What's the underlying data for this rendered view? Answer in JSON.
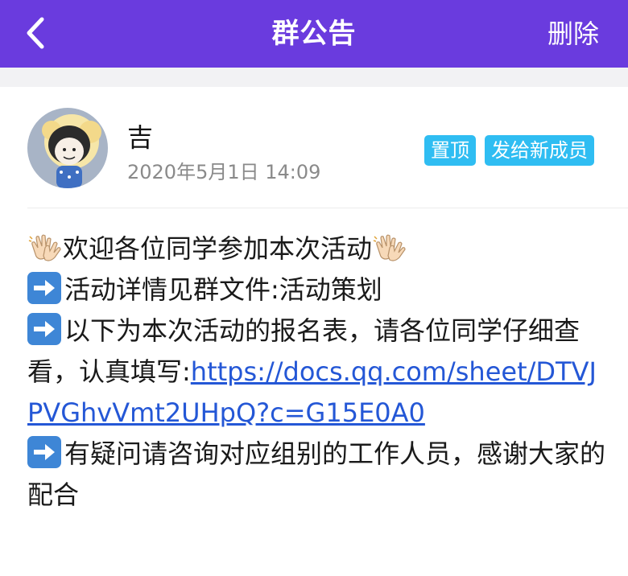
{
  "header": {
    "title": "群公告",
    "delete_label": "删除",
    "bg_color": "#6a3bde"
  },
  "post": {
    "author": "吉",
    "timestamp": "2020年5月1日 14:09",
    "tags": {
      "pin": "置顶",
      "send_to_new": "发给新成员"
    },
    "tag_color": "#2fbdf2"
  },
  "content": {
    "line1": "欢迎各位同学参加本次活动",
    "line2": "活动详情见群文件:活动策划",
    "line3": "以下为本次活动的报名表，请各位同学仔细查看，认真填写:",
    "link": "https://docs.qq.com/sheet/DTVJPVGhvVmt2UHpQ?c=G15E0A0",
    "line4": "有疑问请咨询对应组别的工作人员，感谢大家的配合",
    "icons": [
      "clapping-hands-icon",
      "right-arrow-icon"
    ]
  }
}
